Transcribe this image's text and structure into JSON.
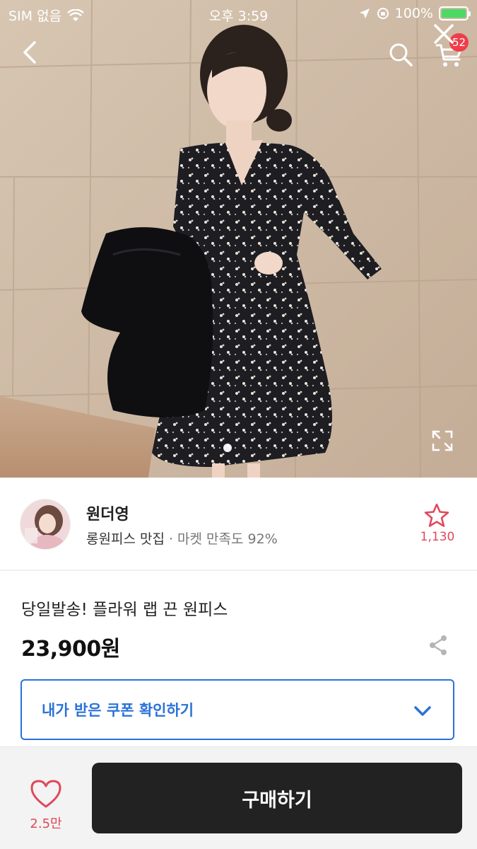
{
  "status_bar": {
    "carrier": "SIM 없음",
    "time": "오후 3:59",
    "battery": "100%"
  },
  "header": {
    "cart_badge": "52",
    "icons": [
      "back-icon",
      "search-icon",
      "cart-icon",
      "close-icon"
    ]
  },
  "gallery": {
    "current_page": 1,
    "icons": [
      "expand-icon"
    ]
  },
  "seller": {
    "name": "원더영",
    "tagline": "롱원피스 맛집",
    "satisfaction": "· 마켓 만족도 92%",
    "favorite_count": "1,130"
  },
  "product": {
    "title": "당일발송! 플라워 랩 끈 원피스",
    "price": "23,900원"
  },
  "coupon": {
    "label": "내가 받은 쿠폰 확인하기"
  },
  "bottom_bar": {
    "like_count": "2.5만",
    "buy_label": "구매하기"
  },
  "colors": {
    "accent_blue": "#2a72d8",
    "like_red": "#e0485a",
    "badge_red": "#ef3e4a",
    "buy_button": "#222222"
  }
}
